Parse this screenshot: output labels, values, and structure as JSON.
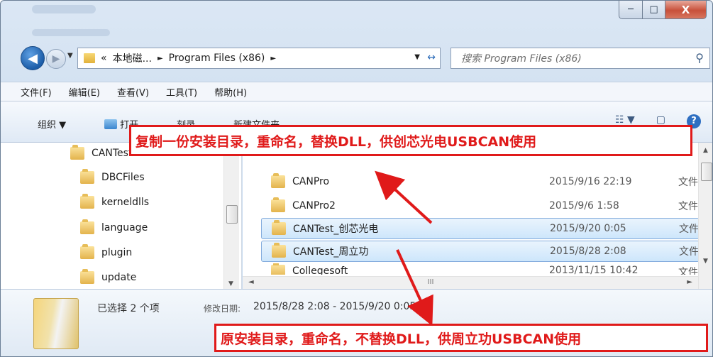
{
  "window": {
    "buttons": {
      "min": "─",
      "max": "□",
      "close": "X"
    }
  },
  "address": {
    "crumbs": [
      "«",
      "本地磁...",
      "►",
      "Program Files (x86)",
      "►"
    ],
    "dropdown": "▼",
    "refresh": "↔"
  },
  "search": {
    "placeholder": "搜索 Program Files (x86)",
    "icon": "⚲"
  },
  "menu": [
    "文件(F)",
    "编辑(E)",
    "查看(V)",
    "工具(T)",
    "帮助(H)"
  ],
  "toolbar": {
    "organize": "组织 ▼",
    "open": "打开",
    "burn": "刻录",
    "new_folder": "新建文件夹",
    "view_icon": "☷ ▼",
    "pane_icon": "▢",
    "help_icon": "?"
  },
  "tree": {
    "root": "CANTest",
    "items": [
      "DBCFiles",
      "kerneldlls",
      "language",
      "plugin",
      "update"
    ]
  },
  "files": [
    {
      "name": "CANPro",
      "date": "2015/9/16 22:19",
      "type": "文件",
      "selected": false
    },
    {
      "name": "CANPro2",
      "date": "2015/9/6 1:58",
      "type": "文件",
      "selected": false
    },
    {
      "name": "CANTest_创芯光电",
      "date": "2015/9/20 0:05",
      "type": "文件",
      "selected": true
    },
    {
      "name": "CANTest_周立功",
      "date": "2015/8/28 2:08",
      "type": "文件",
      "selected": true
    },
    {
      "name": "Collegesoft",
      "date": "2013/11/15 10:42",
      "type": "文件",
      "selected": false
    }
  ],
  "details": {
    "selection_count": "已选择 2 个项",
    "modified_label": "修改日期:",
    "modified_value": "2015/8/28 2:08 - 2015/9/20 0:05"
  },
  "annotations": {
    "top": "复制一份安装目录，重命名，替换DLL，供创芯光电USBCAN使用",
    "bottom": "原安装目录，重命名，不替换DLL，供周立功USBCAN使用",
    "color": "#e01a1a"
  },
  "scroll": {
    "hthumb": "III"
  }
}
